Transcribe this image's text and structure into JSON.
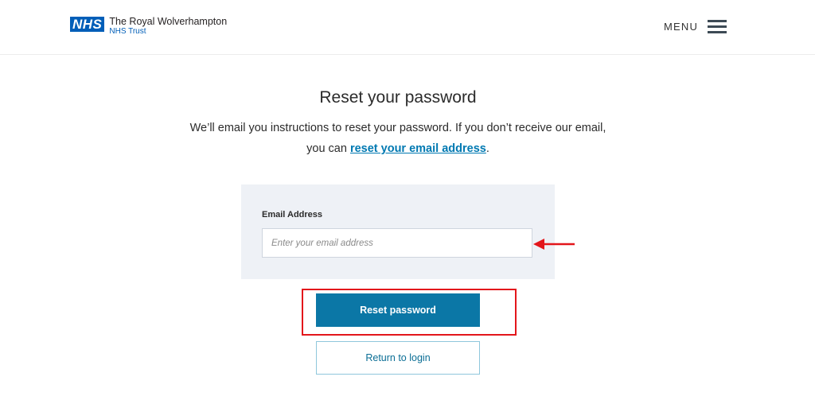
{
  "header": {
    "logo_badge": "NHS",
    "org_name": "The Royal Wolverhampton",
    "org_subtitle": "NHS Trust",
    "menu_label": "MENU",
    "menu_icon": "hamburger-icon"
  },
  "main": {
    "title": "Reset your password",
    "intro_text": "We’ll email you instructions to reset your password. If you don’t receive our email, you can ",
    "intro_link": "reset your email address",
    "intro_end": "."
  },
  "form": {
    "email_label": "Email Address",
    "email_value": "",
    "email_placeholder": "Enter your email address",
    "reset_button": "Reset password",
    "return_button": "Return to login"
  },
  "annotations": {
    "arrow_icon": "arrow-left-icon",
    "highlight_color": "#e3161b"
  },
  "colors": {
    "nhs_blue": "#005eb8",
    "primary_button": "#0b77a6",
    "link": "#0079b2",
    "panel_bg": "#eef1f6"
  }
}
